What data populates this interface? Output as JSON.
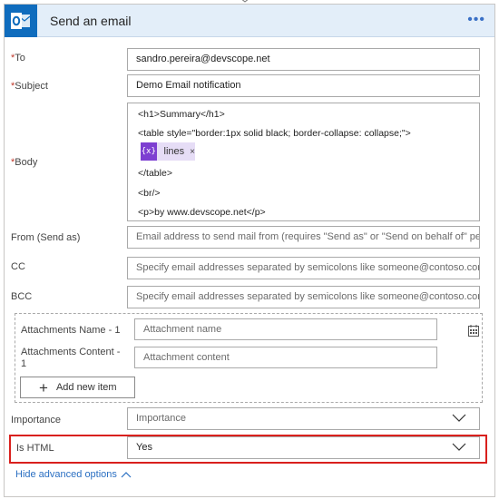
{
  "header": {
    "title": "Send an email",
    "more_label": "•••",
    "brand_color": "#0f6cbd",
    "icon": "outlook-icon"
  },
  "fields": {
    "to": {
      "label": "To",
      "required_mark": "*",
      "value": "sandro.pereira@devscope.net"
    },
    "subject": {
      "label": "Subject",
      "required_mark": "*",
      "value": "Demo Email notification"
    },
    "body": {
      "label": "Body",
      "required_mark": "*",
      "lines": [
        "<h1>Summary</h1>",
        "<table style=\"border:1px solid black; border-collapse: collapse;\">",
        "</table>",
        "<br/>",
        "<p>by www.devscope.net</p>"
      ],
      "token": {
        "icon_text": "{x}",
        "label": "lines",
        "remove": "×"
      }
    },
    "from": {
      "label": "From (Send as)",
      "placeholder": "Email address to send mail from (requires \"Send as\" or \"Send on behalf of\" pe"
    },
    "cc": {
      "label": "CC",
      "placeholder": "Specify email addresses separated by semicolons like someone@contoso.com"
    },
    "bcc": {
      "label": "BCC",
      "placeholder": "Specify email addresses separated by semicolons like someone@contoso.com"
    }
  },
  "attachments": {
    "name_label": "Attachments Name - 1",
    "name_placeholder": "Attachment name",
    "content_label_line1": "Attachments Content -",
    "content_label_line2": "1",
    "content_placeholder": "Attachment content",
    "add_item_label": "Add new item"
  },
  "importance": {
    "label": "Importance",
    "value": "Importance"
  },
  "is_html": {
    "label": "Is HTML",
    "value": "Yes",
    "highlight_color": "#d9201d"
  },
  "footer": {
    "hide_advanced_label": "Hide advanced options"
  }
}
